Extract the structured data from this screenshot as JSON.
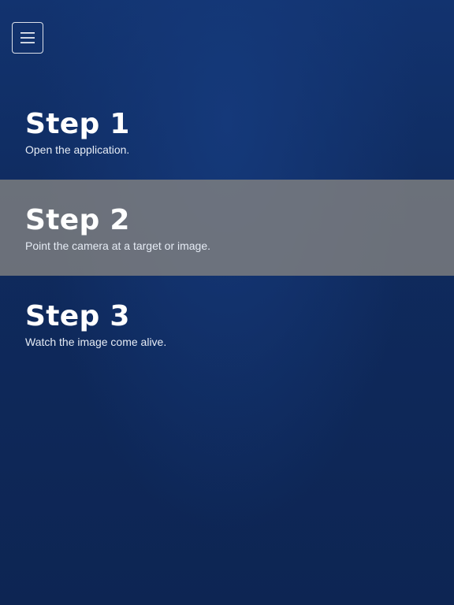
{
  "menu": {
    "icon": "hamburger-menu-icon"
  },
  "steps": [
    {
      "title": "Step 1",
      "description": "Open the application."
    },
    {
      "title": "Step 2",
      "description": "Point the camera at a target or image."
    },
    {
      "title": "Step 3",
      "description": "Watch the image come alive."
    }
  ],
  "colors": {
    "background": "#0e2654",
    "highlight_band": "#808080",
    "text": "#ffffff"
  }
}
